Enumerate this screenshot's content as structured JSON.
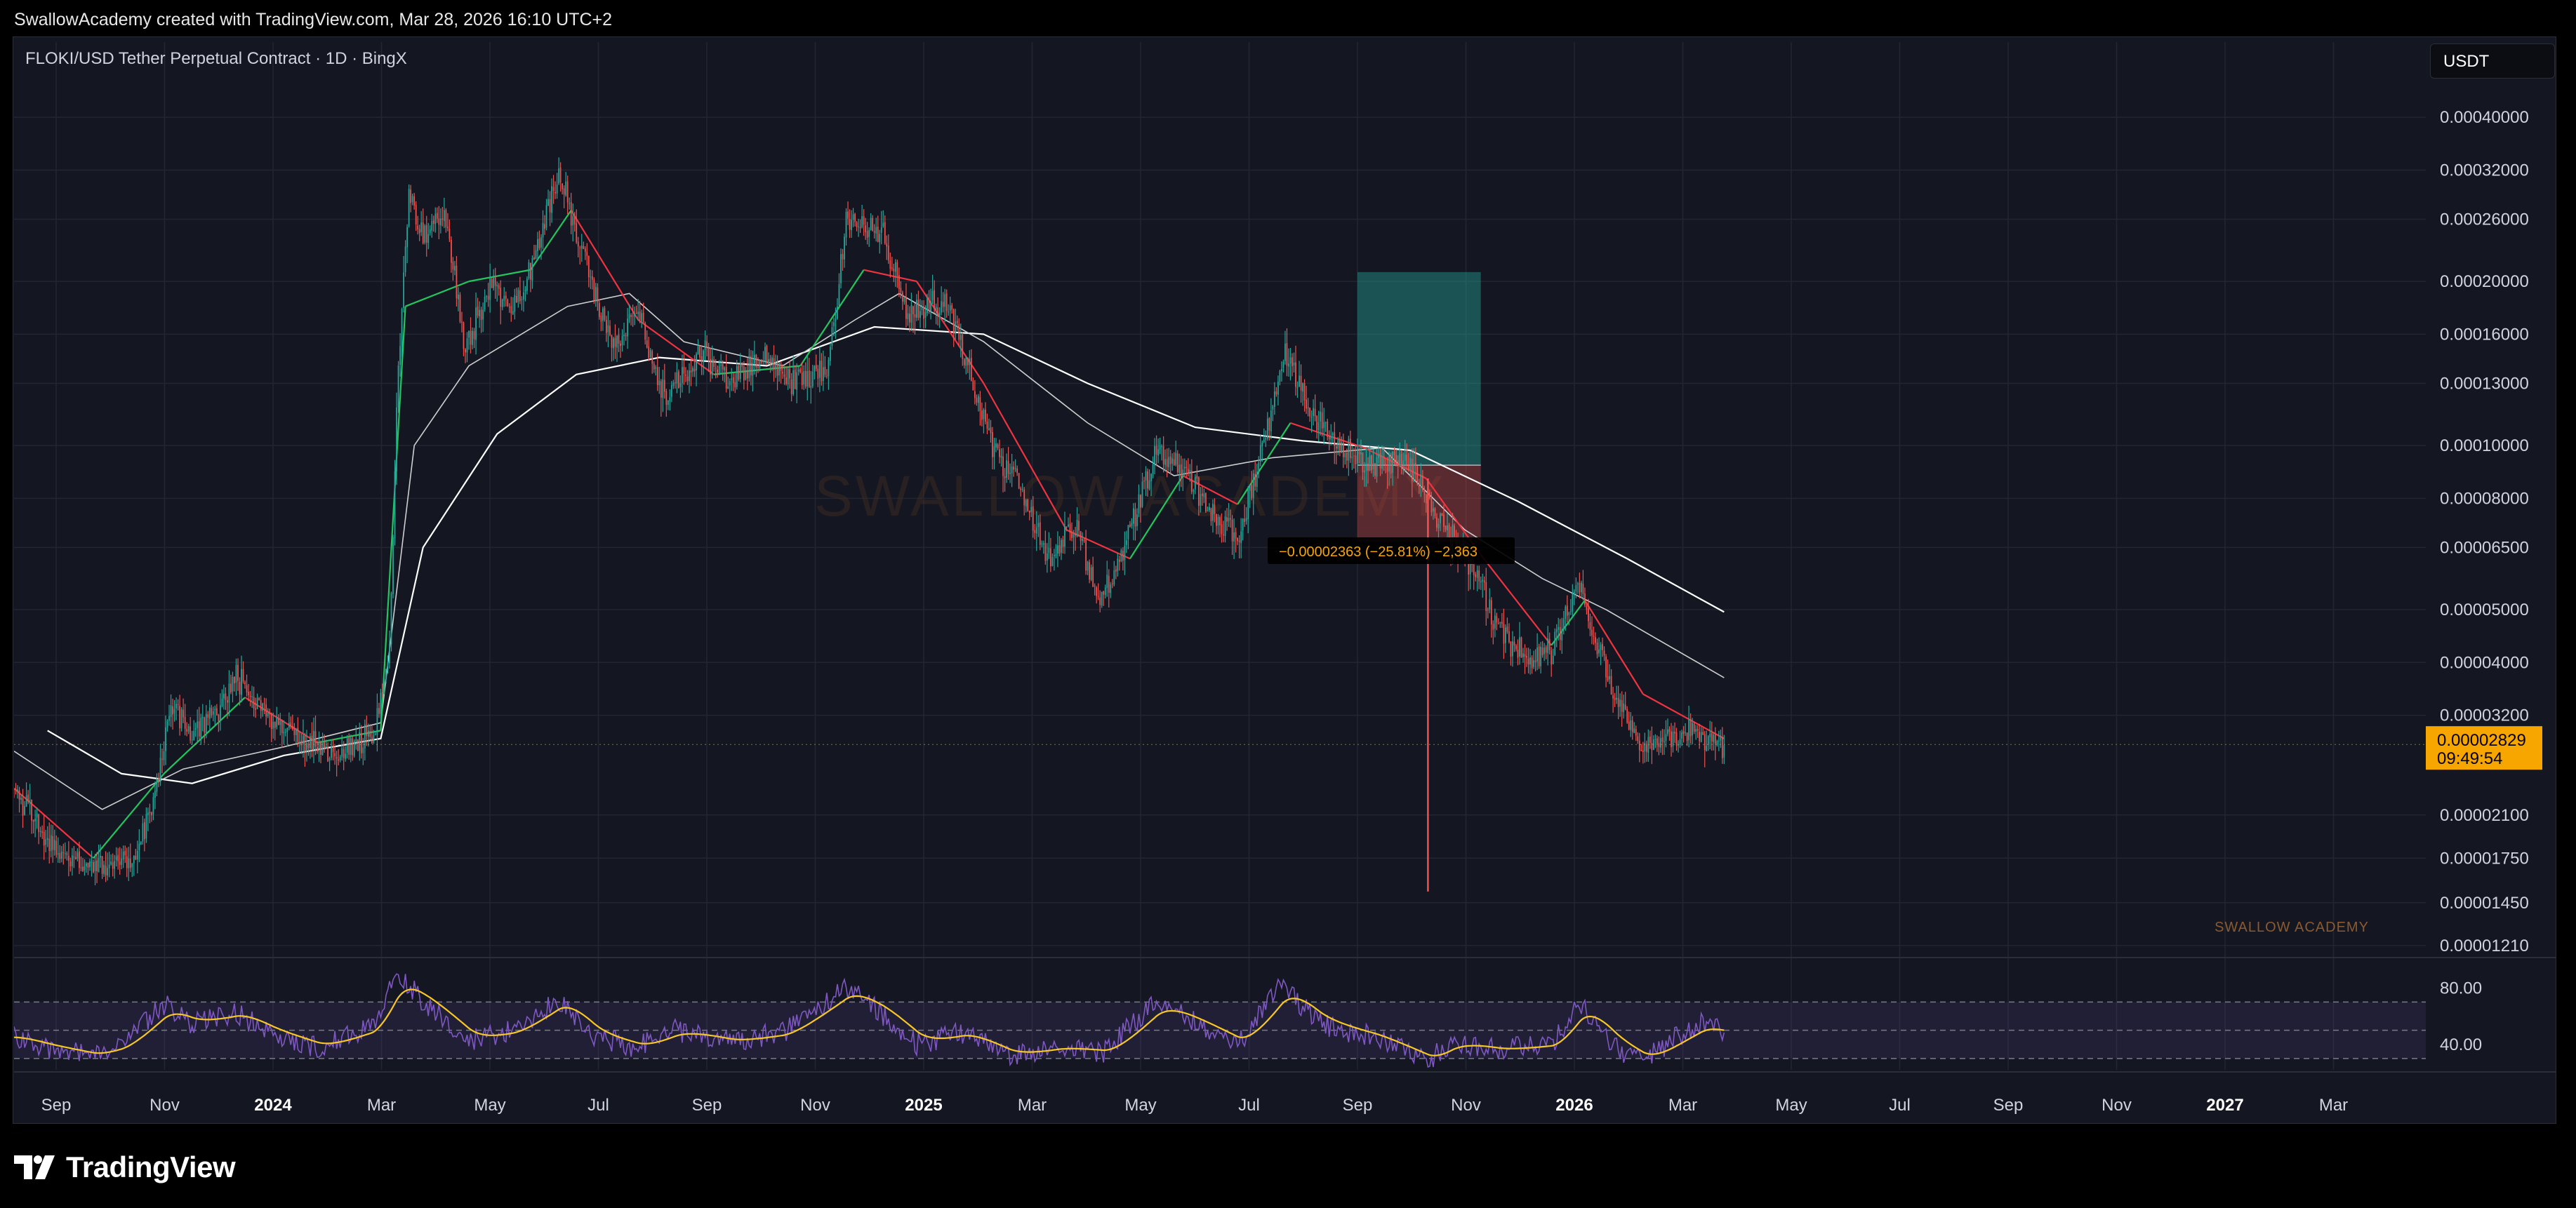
{
  "header": {
    "text": "SwallowAcademy created with TradingView.com, Mar 28, 2026 16:10 UTC+2"
  },
  "symbol": {
    "text": "FLOKI/USD Tether Perpetual Contract · 1D · BingX"
  },
  "currency_button": {
    "label": "USDT"
  },
  "watermark": {
    "main": "SWALLOW ACADEMY",
    "corner": "SWALLOW ACADEMY"
  },
  "footer": {
    "brand": "TradingView"
  },
  "colors": {
    "background": "#141722",
    "up": "#26a69a",
    "down": "#ef5350",
    "ma_fast_up": "#22c55e",
    "ma_fast_down": "#ef3340",
    "ma_slow": "#ffffff",
    "rsi": "#7e57c2",
    "rsi_ma": "#f7c825",
    "price_tag": "#f7a600",
    "profit_zone": "#26a69a",
    "loss_zone": "#ef5350"
  },
  "chart_data": {
    "type": "candlestick",
    "scale": "log",
    "grid": true,
    "price_axis": {
      "ticks": [
        "0.00040000",
        "0.00032000",
        "0.00026000",
        "0.00020000",
        "0.00016000",
        "0.00013000",
        "0.00010000",
        "0.00008000",
        "0.00006500",
        "0.00005000",
        "0.00004000",
        "0.00003200",
        "0.00002100",
        "0.00001750",
        "0.00001450",
        "0.00001210"
      ],
      "tick_values": [
        0.0004,
        0.00032,
        0.00026,
        0.0002,
        0.00016,
        0.00013,
        0.0001,
        8e-05,
        6.5e-05,
        5e-05,
        4e-05,
        3.2e-05,
        2.1e-05,
        1.75e-05,
        1.45e-05,
        1.21e-05
      ],
      "range": [
        1.15e-05,
        0.00046
      ]
    },
    "time_axis": {
      "labels": [
        "Sep",
        "Nov",
        "2024",
        "Mar",
        "May",
        "Jul",
        "Sep",
        "Nov",
        "2025",
        "Mar",
        "May",
        "Jul",
        "Sep",
        "Nov",
        "2026",
        "Mar",
        "May",
        "Jul",
        "Sep",
        "Nov",
        "2027",
        "Mar"
      ],
      "bold": [
        "2024",
        "2025",
        "2026",
        "2027"
      ],
      "range": [
        "2023-08-01",
        "2027-04-30"
      ]
    },
    "last_price": {
      "value": "0.00002829",
      "countdown": "09:49:54",
      "num": 2.829e-05
    },
    "price_path": [
      [
        "2023-08-01",
        2.35e-05
      ],
      [
        "2023-08-20",
        1.9e-05
      ],
      [
        "2023-09-10",
        1.65e-05
      ],
      [
        "2023-09-25",
        1.72e-05
      ],
      [
        "2023-10-08",
        1.78e-05
      ],
      [
        "2023-10-20",
        2.25e-05
      ],
      [
        "2023-10-28",
        3.3e-05
      ],
      [
        "2023-11-10",
        3e-05
      ],
      [
        "2023-11-25",
        3.2e-05
      ],
      [
        "2023-12-05",
        3.8e-05
      ],
      [
        "2023-12-15",
        3.4e-05
      ],
      [
        "2023-12-25",
        3.2e-05
      ],
      [
        "2024-01-10",
        2.9e-05
      ],
      [
        "2024-01-25",
        2.75e-05
      ],
      [
        "2024-02-10",
        2.8e-05
      ],
      [
        "2024-02-22",
        3e-05
      ],
      [
        "2024-03-01",
        4.2e-05
      ],
      [
        "2024-03-05",
        0.00012
      ],
      [
        "2024-03-12",
        0.00029
      ],
      [
        "2024-03-20",
        0.00024
      ],
      [
        "2024-04-01",
        0.00027
      ],
      [
        "2024-04-13",
        0.00015
      ],
      [
        "2024-04-28",
        0.0002
      ],
      [
        "2024-05-10",
        0.000175
      ],
      [
        "2024-05-22",
        0.00022
      ],
      [
        "2024-06-05",
        0.00032
      ],
      [
        "2024-06-18",
        0.00023
      ],
      [
        "2024-07-05",
        0.00015
      ],
      [
        "2024-07-20",
        0.000175
      ],
      [
        "2024-08-05",
        0.00012
      ],
      [
        "2024-08-25",
        0.00015
      ],
      [
        "2024-09-10",
        0.00013
      ],
      [
        "2024-09-28",
        0.00015
      ],
      [
        "2024-10-15",
        0.00013
      ],
      [
        "2024-11-05",
        0.00014
      ],
      [
        "2024-11-15",
        0.00026
      ],
      [
        "2024-12-05",
        0.00025
      ],
      [
        "2024-12-20",
        0.000175
      ],
      [
        "2025-01-10",
        0.000185
      ],
      [
        "2025-01-25",
        0.000135
      ],
      [
        "2025-02-05",
        0.0001
      ],
      [
        "2025-02-20",
        8.5e-05
      ],
      [
        "2025-03-10",
        6.2e-05
      ],
      [
        "2025-03-25",
        7.2e-05
      ],
      [
        "2025-04-08",
        5.1e-05
      ],
      [
        "2025-04-22",
        6.6e-05
      ],
      [
        "2025-05-10",
        9.8e-05
      ],
      [
        "2025-05-25",
        9e-05
      ],
      [
        "2025-06-10",
        7.6e-05
      ],
      [
        "2025-06-25",
        6.8e-05
      ],
      [
        "2025-07-10",
        0.0001
      ],
      [
        "2025-07-22",
        0.00015
      ],
      [
        "2025-08-05",
        0.000115
      ],
      [
        "2025-08-25",
        9.8e-05
      ],
      [
        "2025-09-10",
        9.1e-05
      ],
      [
        "2025-09-25",
        9.5e-05
      ],
      [
        "2025-10-05",
        8.8e-05
      ],
      [
        "2025-10-11",
        8e-05
      ],
      [
        "2025-10-20",
        7.2e-05
      ],
      [
        "2025-11-05",
        6e-05
      ],
      [
        "2025-11-20",
        4.6e-05
      ],
      [
        "2025-12-05",
        4.1e-05
      ],
      [
        "2025-12-20",
        4.2e-05
      ],
      [
        "2026-01-05",
        5.6e-05
      ],
      [
        "2026-01-15",
        4.3e-05
      ],
      [
        "2026-01-28",
        3.3e-05
      ],
      [
        "2026-02-10",
        2.8e-05
      ],
      [
        "2026-02-25",
        2.9e-05
      ],
      [
        "2026-03-10",
        3e-05
      ],
      [
        "2026-03-28",
        2.83e-05
      ]
    ],
    "flash_wick": {
      "date": "2025-10-11",
      "high": 8.7e-05,
      "low": 1.52e-05
    },
    "ma_slow_path": [
      [
        "2023-08-20",
        3e-05
      ],
      [
        "2023-10-01",
        2.5e-05
      ],
      [
        "2023-11-10",
        2.4e-05
      ],
      [
        "2024-01-01",
        2.7e-05
      ],
      [
        "2024-02-25",
        2.9e-05
      ],
      [
        "2024-03-20",
        6.5e-05
      ],
      [
        "2024-05-01",
        0.000105
      ],
      [
        "2024-06-15",
        0.000135
      ],
      [
        "2024-08-01",
        0.000145
      ],
      [
        "2024-10-01",
        0.00014
      ],
      [
        "2024-12-01",
        0.000165
      ],
      [
        "2025-02-01",
        0.00016
      ],
      [
        "2025-04-01",
        0.00013
      ],
      [
        "2025-06-01",
        0.000108
      ],
      [
        "2025-08-01",
        0.000102
      ],
      [
        "2025-10-01",
        9.8e-05
      ],
      [
        "2025-12-01",
        7.9e-05
      ],
      [
        "2026-02-01",
        6.2e-05
      ],
      [
        "2026-03-28",
        4.95e-05
      ]
    ],
    "ma_mid_path": [
      [
        "2023-08-01",
        2.75e-05
      ],
      [
        "2023-09-20",
        2.15e-05
      ],
      [
        "2023-11-05",
        2.55e-05
      ],
      [
        "2024-01-01",
        2.8e-05
      ],
      [
        "2024-02-25",
        3.1e-05
      ],
      [
        "2024-03-15",
        0.0001
      ],
      [
        "2024-04-15",
        0.00014
      ],
      [
        "2024-06-10",
        0.00018
      ],
      [
        "2024-07-15",
        0.00019
      ],
      [
        "2024-08-15",
        0.000155
      ],
      [
        "2024-10-10",
        0.00014
      ],
      [
        "2024-11-20",
        0.00017
      ],
      [
        "2024-12-15",
        0.00019
      ],
      [
        "2025-02-01",
        0.000155
      ],
      [
        "2025-04-01",
        0.00011
      ],
      [
        "2025-05-20",
        8.8e-05
      ],
      [
        "2025-07-15",
        9.5e-05
      ],
      [
        "2025-09-15",
        9.9e-05
      ],
      [
        "2025-11-01",
        7e-05
      ],
      [
        "2025-12-15",
        5.7e-05
      ],
      [
        "2026-01-20",
        5e-05
      ],
      [
        "2026-03-28",
        3.75e-05
      ]
    ],
    "ma_fast_path": [
      [
        "2023-08-01",
        2.35e-05
      ],
      [
        "2023-09-15",
        1.75e-05
      ],
      [
        "2023-10-25",
        2.5e-05
      ],
      [
        "2023-12-10",
        3.45e-05
      ],
      [
        "2024-01-20",
        2.85e-05
      ],
      [
        "2024-02-25",
        3e-05
      ],
      [
        "2024-03-10",
        0.00018
      ],
      [
        "2024-04-15",
        0.0002
      ],
      [
        "2024-05-20",
        0.00021
      ],
      [
        "2024-06-12",
        0.00027
      ],
      [
        "2024-07-20",
        0.00017
      ],
      [
        "2024-09-01",
        0.000135
      ],
      [
        "2024-10-20",
        0.00014
      ],
      [
        "2024-11-25",
        0.00021
      ],
      [
        "2024-12-25",
        0.0002
      ],
      [
        "2025-02-01",
        0.00013
      ],
      [
        "2025-03-20",
        7e-05
      ],
      [
        "2025-04-25",
        6.2e-05
      ],
      [
        "2025-05-25",
        8.8e-05
      ],
      [
        "2025-06-25",
        7.8e-05
      ],
      [
        "2025-07-25",
        0.00011
      ],
      [
        "2025-09-05",
        9.9e-05
      ],
      [
        "2025-10-10",
        8.7e-05
      ],
      [
        "2025-11-10",
        6.3e-05
      ],
      [
        "2025-12-20",
        4.3e-05
      ],
      [
        "2026-01-08",
        5.2e-05
      ],
      [
        "2026-02-10",
        3.5e-05
      ],
      [
        "2026-03-28",
        2.9e-05
      ]
    ],
    "position": {
      "start": "2025-09-01",
      "end": "2025-11-10",
      "target": 0.000208,
      "entry": 9.2e-05,
      "stop": 6.65e-05,
      "label": "−0.00002363 (−25.81%) −2,363"
    },
    "rsi": {
      "axis_ticks": [
        "80.00",
        "40.00"
      ],
      "axis_values": [
        80,
        40
      ],
      "upper": 70,
      "middle": 50,
      "lower": 30,
      "range": [
        22,
        100
      ],
      "path": [
        [
          "2023-08-01",
          45
        ],
        [
          "2023-08-20",
          38
        ],
        [
          "2023-09-15",
          32
        ],
        [
          "2023-10-01",
          40
        ],
        [
          "2023-10-25",
          68
        ],
        [
          "2023-11-10",
          55
        ],
        [
          "2023-12-05",
          62
        ],
        [
          "2023-12-25",
          48
        ],
        [
          "2024-01-20",
          38
        ],
        [
          "2024-02-20",
          52
        ],
        [
          "2024-03-05",
          92
        ],
        [
          "2024-03-20",
          70
        ],
        [
          "2024-04-15",
          42
        ],
        [
          "2024-05-10",
          50
        ],
        [
          "2024-06-05",
          72
        ],
        [
          "2024-06-25",
          45
        ],
        [
          "2024-07-20",
          38
        ],
        [
          "2024-08-10",
          50
        ],
        [
          "2024-09-10",
          42
        ],
        [
          "2024-10-10",
          48
        ],
        [
          "2024-11-15",
          80
        ],
        [
          "2024-12-05",
          62
        ],
        [
          "2024-12-25",
          40
        ],
        [
          "2025-01-20",
          48
        ],
        [
          "2025-02-15",
          32
        ],
        [
          "2025-03-15",
          38
        ],
        [
          "2025-04-10",
          35
        ],
        [
          "2025-05-10",
          70
        ],
        [
          "2025-06-01",
          55
        ],
        [
          "2025-06-25",
          40
        ],
        [
          "2025-07-20",
          82
        ],
        [
          "2025-08-10",
          55
        ],
        [
          "2025-09-10",
          45
        ],
        [
          "2025-10-11",
          28
        ],
        [
          "2025-10-25",
          42
        ],
        [
          "2025-11-20",
          36
        ],
        [
          "2025-12-20",
          40
        ],
        [
          "2026-01-05",
          70
        ],
        [
          "2026-01-25",
          38
        ],
        [
          "2026-02-10",
          28
        ],
        [
          "2026-03-01",
          45
        ],
        [
          "2026-03-15",
          55
        ],
        [
          "2026-03-28",
          48
        ]
      ]
    }
  }
}
